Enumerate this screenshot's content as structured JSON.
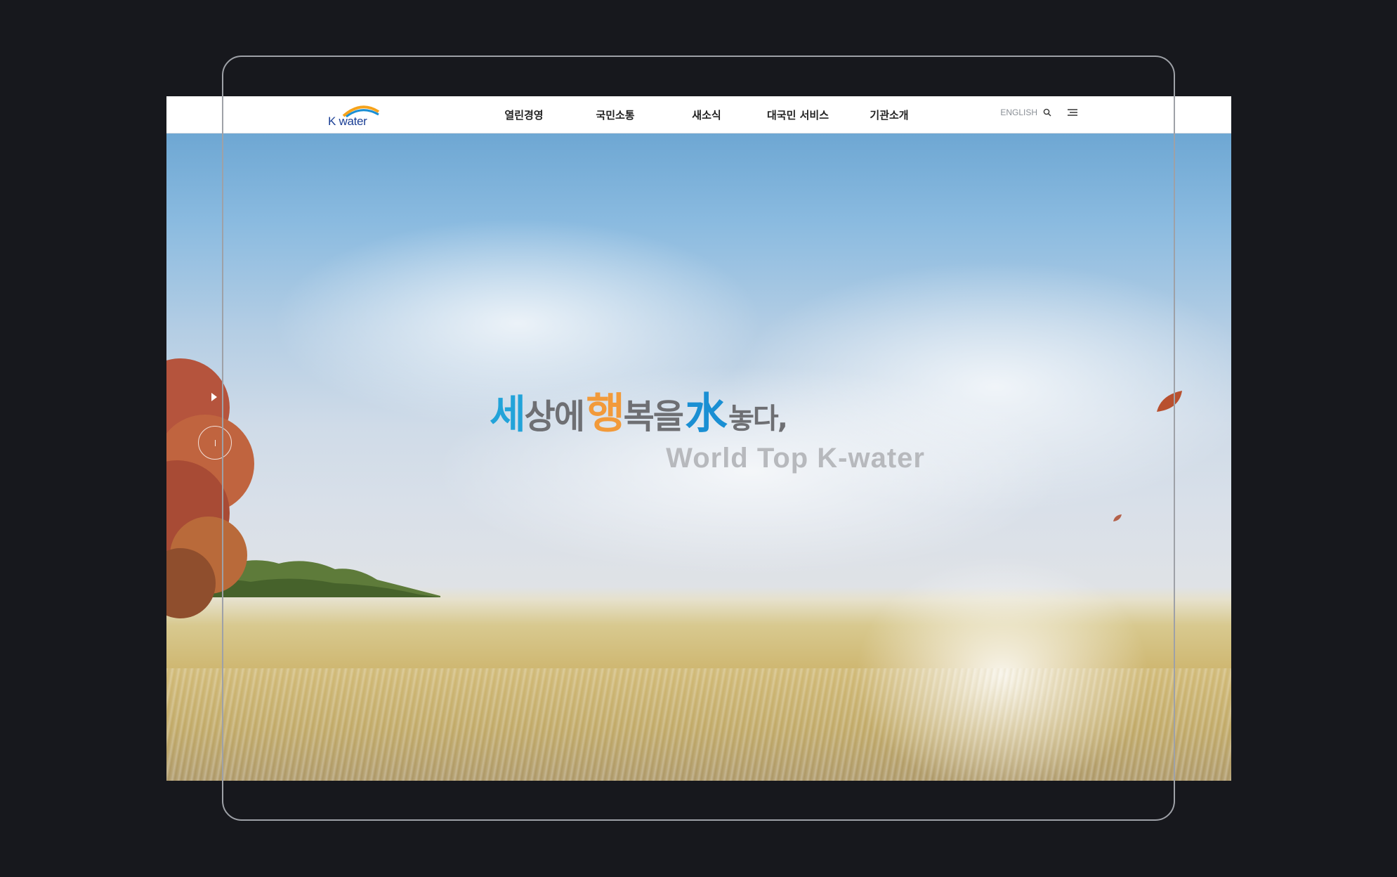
{
  "header": {
    "logo_text": "K water",
    "nav": [
      {
        "label": "열린경영"
      },
      {
        "label": "국민소통"
      },
      {
        "label": "새소식"
      },
      {
        "label": "대국민 서비스"
      },
      {
        "label": "기관소개"
      }
    ],
    "language": "ENGLISH",
    "search_icon": "search-icon",
    "menu_icon": "hamburger-menu-icon"
  },
  "hero": {
    "slogan": {
      "part1": "세",
      "part2": "상에",
      "part3": "행",
      "part4": "복을",
      "part5": "水",
      "part6": "놓다,"
    },
    "subtitle": "World Top K-water",
    "controls": {
      "play_icon": "play-icon",
      "indicator_icon": "slide-indicator-icon"
    }
  },
  "colors": {
    "background": "#17181d",
    "brand_blue": "#22a3d9",
    "brand_orange": "#f29a3a",
    "brand_navy": "#1b3f95",
    "frame": "#9ea1a7"
  }
}
